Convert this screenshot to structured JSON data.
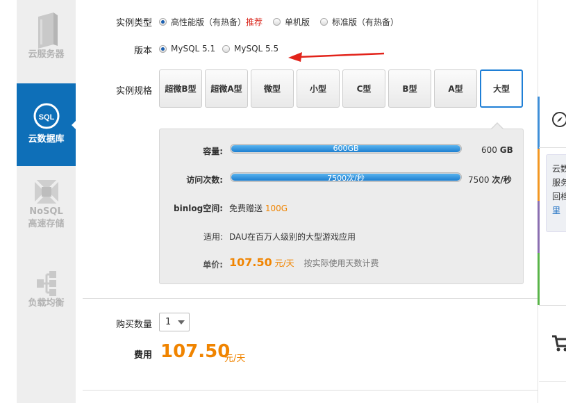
{
  "sidebar": {
    "items": [
      {
        "label": "云服务器",
        "icon": "server-icon"
      },
      {
        "label": "云数据库",
        "icon": "sql-database-icon",
        "active": true
      },
      {
        "label_line1": "NoSQL",
        "label_line2": "高速存储",
        "icon": "nosql-storage-icon"
      },
      {
        "label": "负载均衡",
        "icon": "load-balancer-icon"
      }
    ]
  },
  "form": {
    "instance_type": {
      "label": "实例类型",
      "options": [
        {
          "label": "高性能版（有热备）",
          "selected": true,
          "tag": "推荐"
        },
        {
          "label": "单机版",
          "selected": false
        },
        {
          "label": "标准版（有热备）",
          "selected": false
        }
      ]
    },
    "version": {
      "label": "版本",
      "options": [
        {
          "label": "MySQL 5.1",
          "selected": true
        },
        {
          "label": "MySQL 5.5",
          "selected": false
        }
      ]
    },
    "spec": {
      "label": "实例规格",
      "options": [
        "超微B型",
        "超微A型",
        "微型",
        "小型",
        "C型",
        "B型",
        "A型",
        "大型"
      ],
      "selected": "大型"
    }
  },
  "detail": {
    "capacity": {
      "label": "容量:",
      "bar_text": "600GB",
      "value_num": "600",
      "value_unit": "GB",
      "fill_fraction": 1.0
    },
    "visits": {
      "label": "访问次数:",
      "bar_text": "7500次/秒",
      "value_num": "7500",
      "value_unit": "次/秒",
      "fill_fraction": 1.0
    },
    "binlog": {
      "label": "binlog空间:",
      "text": "免费赠送",
      "amount": "100G"
    },
    "usage": {
      "label": "适用:",
      "text": "DAU在百万人级别的大型游戏应用"
    },
    "price": {
      "label": "单价:",
      "amount": "107.50",
      "unit": "元/天",
      "note": "按实际使用天数计费"
    }
  },
  "purchase": {
    "qty_label": "购买数量",
    "qty_value": "1",
    "fee_label": "费用",
    "fee_amount": "107.50",
    "fee_unit": "元/天"
  },
  "right_panel": {
    "box_line1": "云数",
    "box_line2": "服务",
    "box_line3": "回档",
    "box_line4": "里"
  },
  "colors": {
    "accent_blue": "#0e6fb8",
    "price_orange": "#f08400",
    "recommend_red": "#d9261c",
    "arrow_red": "#e2231a"
  }
}
